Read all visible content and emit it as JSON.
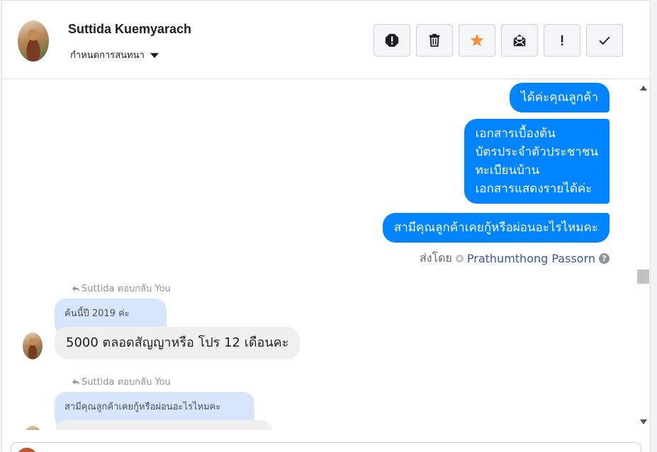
{
  "header": {
    "name": "Suttida Kuemyarach",
    "assign_label": "กำหนดการสนทนา",
    "actions": [
      {
        "icon": "alert-octagon-icon",
        "label": "mark-spam"
      },
      {
        "icon": "trash-icon",
        "label": "delete"
      },
      {
        "icon": "star-icon",
        "label": "star",
        "color": "#f7923a"
      },
      {
        "icon": "envelope-icon",
        "label": "mark-unread"
      },
      {
        "icon": "exclamation-icon",
        "label": "follow-up"
      },
      {
        "icon": "check-icon",
        "label": "done"
      }
    ]
  },
  "messages": {
    "outgoing": [
      "ได้ค่ะคุณลูกค้า",
      "เอกสารเบื้องต้น\nบัตรประจำตัวประชาชน\nทะเบียนบ้าน\nเอกสารแสดงรายได้ค่ะ",
      "สามีคุณลูกค้าเคยกู้หรือผ่อนอะไรไหมคะ"
    ],
    "sent_by_prefix": "ส่งโดย",
    "sent_by_name": "Prathumthong Passorn",
    "replies": [
      {
        "reply_label": "Suttida ตอบกลับ You",
        "quoted": "ค้นนี้ปี 2019 ค่ะ",
        "text": "5000 ตลอดสัญญาหรือ โปร 12 เดือนคะ"
      },
      {
        "reply_label": "Suttida ตอบกลับ You",
        "quoted": "สามีคุณลูกค้าเคยกู้หรือผ่อนอะไรไหมคะ",
        "text": ""
      }
    ]
  },
  "colors": {
    "outgoing_bubble": "#0084ff",
    "incoming_bubble": "#f1f0f0",
    "quoted_bubble": "#d8e6fd",
    "star": "#f7923a"
  }
}
